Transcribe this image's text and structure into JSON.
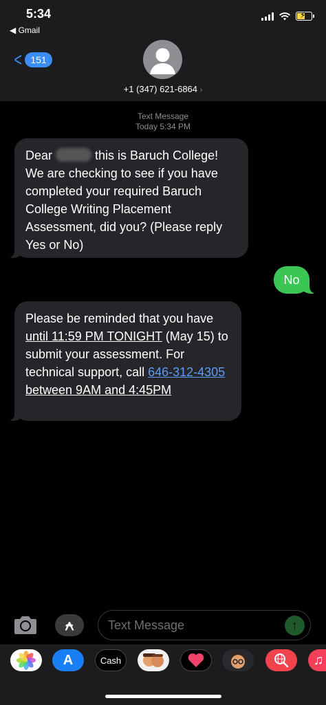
{
  "status_bar": {
    "time": "5:34",
    "back_app": "◀ Gmail",
    "battery_color": "#f7d649"
  },
  "nav": {
    "unread_count": "151",
    "contact_number": "+1 (347) 621-6864",
    "contact_chevron": "›",
    "back_icon": "chevron-left-icon"
  },
  "conversation": {
    "meta_type": "Text Message",
    "meta_time": "Today 5:34 PM",
    "messages": [
      {
        "direction": "incoming",
        "parts": [
          "Dear ",
          " this is Baruch College! We are checking to see if you have completed your required Baruch College Writing Placement Assessment, did you? (Please reply Yes or No)"
        ]
      },
      {
        "direction": "outgoing",
        "text": "No"
      },
      {
        "direction": "incoming",
        "parts": {
          "p1": "Please be reminded that you have ",
          "p2": "until 11:59 PM TONIGHT",
          "p3": " (May 15) to submit your assessment. For technical support, call ",
          "phone": "646-312-4305",
          "p4": "between 9AM and 4:45PM"
        }
      }
    ]
  },
  "composer": {
    "placeholder": "Text Message",
    "camera_icon": "camera-icon",
    "apps_icon": "app-store-icon",
    "send_icon": "arrow-up-icon"
  },
  "app_drawer": {
    "apps": [
      "Photos",
      "App Store",
      "Cash",
      "Memoji Stickers",
      "Digital Touch",
      "Memoji",
      "Search Images",
      "Music"
    ],
    "cash_label": "Cash"
  },
  "colors": {
    "incoming_bubble": "#26252a",
    "outgoing_bubble": "#3ac555",
    "link": "#5b9cf6",
    "header_bg": "#1c1c1e"
  }
}
